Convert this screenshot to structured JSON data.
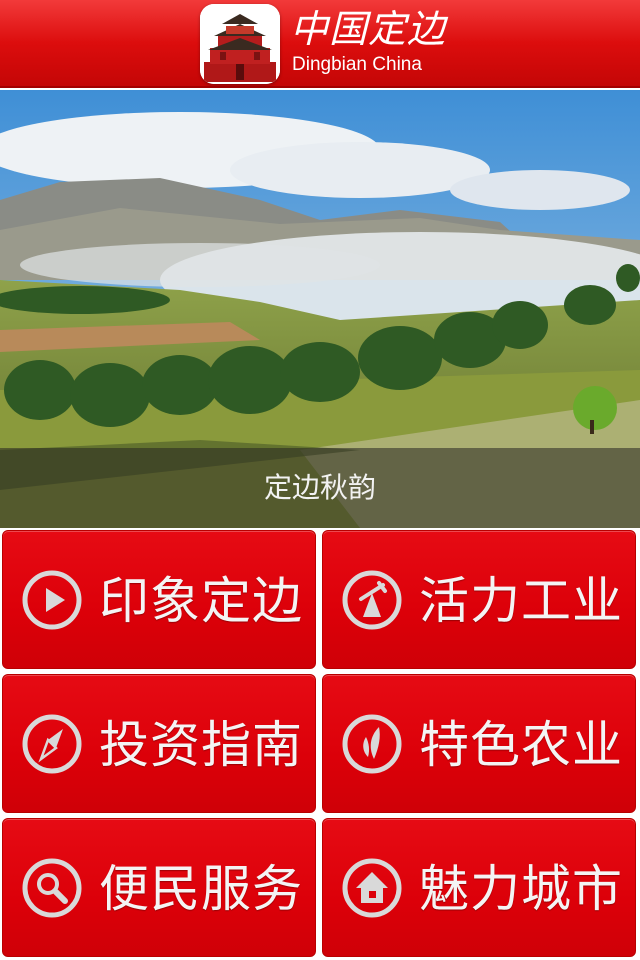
{
  "header": {
    "brand_cn": "中国定边",
    "brand_en": "Dingbian China",
    "logo_icon": "pavilion-logo-icon"
  },
  "banner": {
    "caption": "定边秋韵"
  },
  "menu": {
    "items": [
      {
        "label": "印象定边",
        "icon": "play-icon"
      },
      {
        "label": "活力工业",
        "icon": "industry-icon"
      },
      {
        "label": "投资指南",
        "icon": "compass-icon"
      },
      {
        "label": "特色农业",
        "icon": "wheat-icon"
      },
      {
        "label": "便民服务",
        "icon": "search-icon"
      },
      {
        "label": "魅力城市",
        "icon": "home-icon"
      }
    ]
  },
  "colors": {
    "accent": "#dc0009",
    "header": "#e01010",
    "text": "#f4f4f4"
  }
}
